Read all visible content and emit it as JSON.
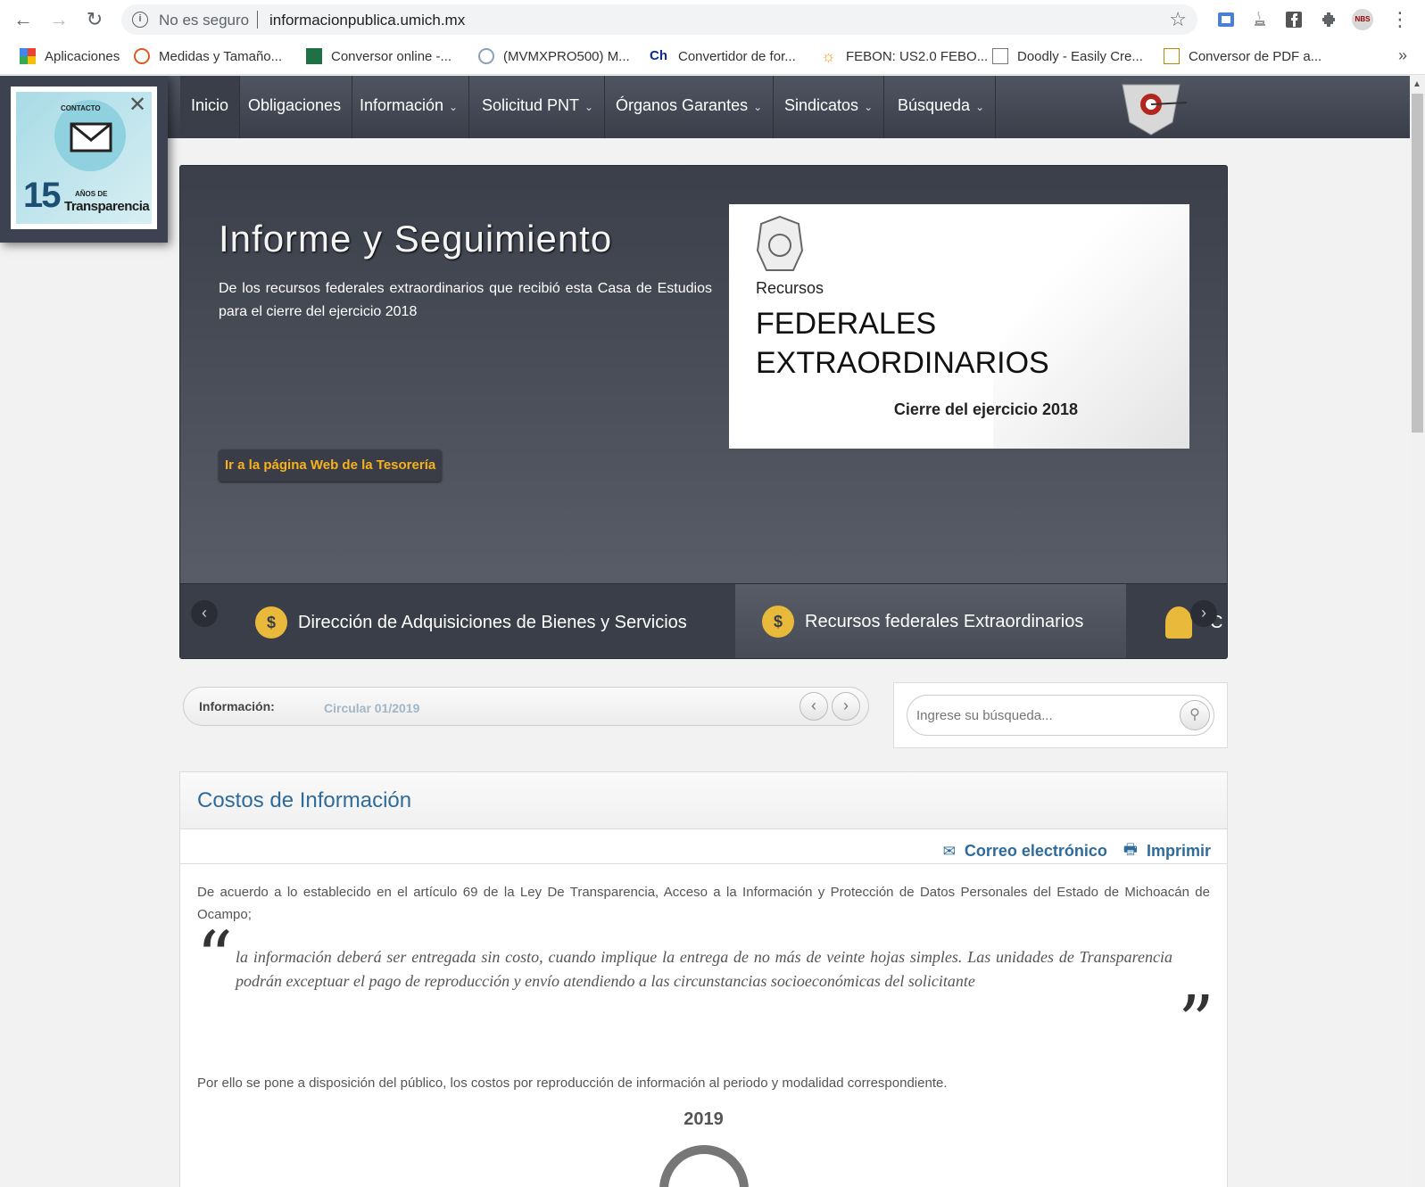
{
  "browser": {
    "insecure_label": "No es seguro",
    "url": "informacionpublica.umich.mx",
    "bookmarks": [
      {
        "label": "Aplicaciones",
        "icon": "apps-grid-icon"
      },
      {
        "label": "Medidas y Tamaño...",
        "icon": "bookmark-favicon"
      },
      {
        "label": "Conversor online -...",
        "icon": "excel-icon"
      },
      {
        "label": "(MVMXPRO500) M...",
        "icon": "globe-icon"
      },
      {
        "label": "Convertidor de for...",
        "icon": "ch-icon"
      },
      {
        "label": "FEBON: US2.0 FEBO...",
        "icon": "sun-icon"
      },
      {
        "label": "Doodly - Easily Cre...",
        "icon": "image-icon"
      },
      {
        "label": "Conversor de PDF a...",
        "icon": "pdf-icon"
      }
    ],
    "more": "»"
  },
  "nav": {
    "items": [
      {
        "label": "Inicio",
        "dropdown": false
      },
      {
        "label": "Obligaciones",
        "dropdown": false
      },
      {
        "label": "Información",
        "dropdown": true
      },
      {
        "label": "Solicitud PNT",
        "dropdown": true
      },
      {
        "label": "Órganos Garantes",
        "dropdown": true
      },
      {
        "label": "Sindicatos",
        "dropdown": true
      },
      {
        "label": "Búsqueda",
        "dropdown": true
      }
    ]
  },
  "popup": {
    "line1": "CONTACTO",
    "line2": "15",
    "line3": "AÑOS DE",
    "line4": "Transparencia"
  },
  "hero": {
    "title": "Informe y Seguimiento",
    "description": "De los recursos federales extraordinarios que recibió esta Casa de Estudios para el cierre del ejercicio 2018",
    "button": "Ir a la página Web de la Tesorería",
    "image": {
      "small": "Recursos",
      "big1": "FEDERALES",
      "big2": "EXTRAORDINARIOS",
      "year": "Cierre del ejercicio 2018"
    },
    "tabs": [
      {
        "label": "Dirección de Adquisiciones de Bienes y Servicios",
        "active": false
      },
      {
        "label": "Recursos federales Extraordinarios",
        "active": true
      },
      {
        "label": "C",
        "active": false
      }
    ]
  },
  "infobar": {
    "label": "Información:",
    "value": "Circular 01/2019"
  },
  "search": {
    "placeholder": "Ingrese su búsqueda..."
  },
  "article": {
    "title": "Costos de Información",
    "email": "Correo electrónico",
    "print": "Imprimir",
    "p1": "De acuerdo a lo establecido en el artículo 69 de la Ley De Transparencia, Acceso a la Información y Protección de Datos Personales del Estado de Michoacán de Ocampo;",
    "quote": "la información deberá ser entregada sin costo, cuando implique la entrega de no más de veinte hojas simples. Las unidades de Transparencia podrán exceptuar el pago de reproducción y envío atendiendo a las circunstancias socioeconómicas del solicitante",
    "p2": "Por ello se pone a disposición del público, los costos por reproducción de información al periodo y modalidad correspondiente.",
    "year": "2019"
  }
}
